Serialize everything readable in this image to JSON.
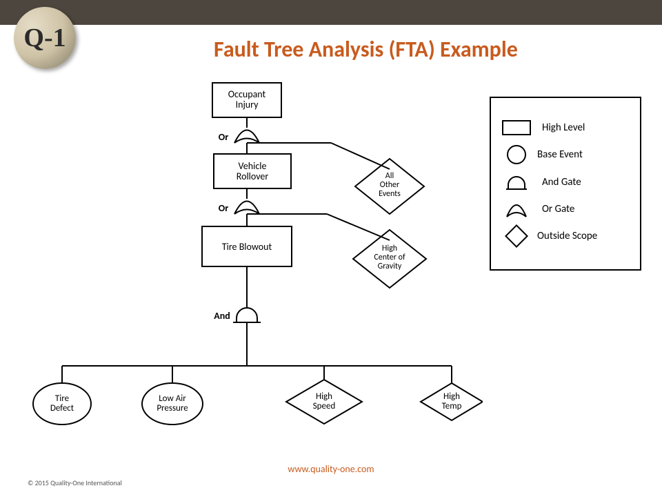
{
  "header": {
    "logo_text": "Q-1",
    "title": "Fault Tree Analysis (FTA) Example"
  },
  "tree": {
    "top": "Occupant Injury",
    "gate1": "Or",
    "level2_box": "Vehicle Rollover",
    "level2_diamond": "All Other Events",
    "gate2": "Or",
    "level3_box": "Tire Blowout",
    "level3_diamond": "High Center of Gravity",
    "gate3": "And",
    "leaves": {
      "circle1": "Tire Defect",
      "circle2": "Low Air Pressure",
      "diamond1": "High Speed",
      "diamond2": "High Temp"
    }
  },
  "legend": {
    "items": [
      {
        "shape": "rect",
        "label": "High Level"
      },
      {
        "shape": "circle",
        "label": "Base Event"
      },
      {
        "shape": "and",
        "label": "And Gate"
      },
      {
        "shape": "or",
        "label": "Or Gate"
      },
      {
        "shape": "diamond",
        "label": "Outside Scope"
      }
    ]
  },
  "footer": {
    "url": "www.quality-one.com",
    "copyright": "© 2015 Quality-One International"
  }
}
